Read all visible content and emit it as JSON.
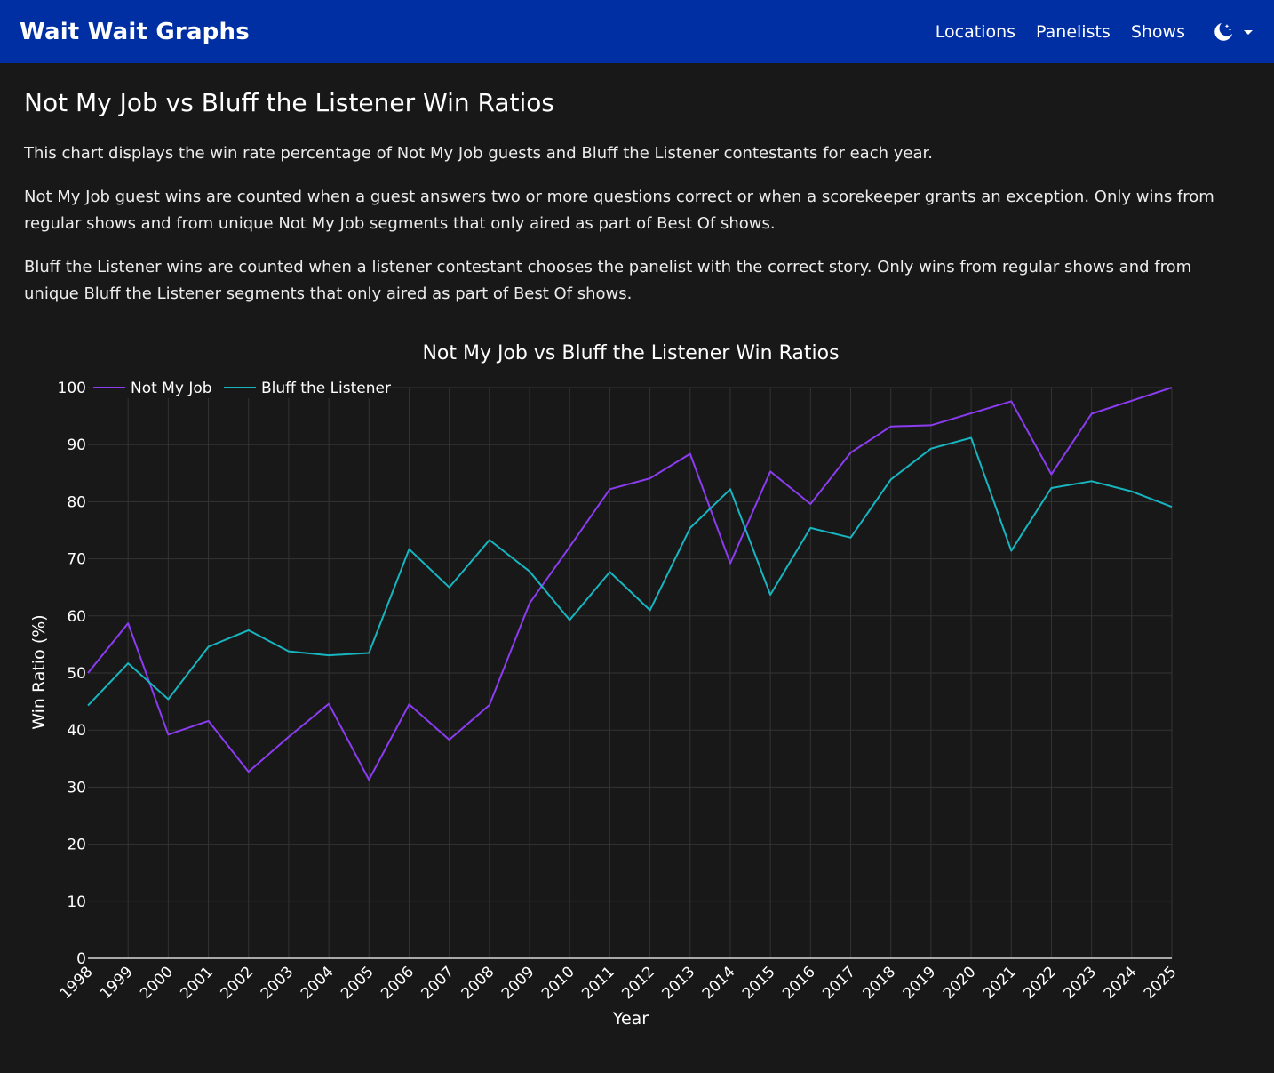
{
  "navbar": {
    "brand": "Wait Wait Graphs",
    "links": [
      "Locations",
      "Panelists",
      "Shows"
    ],
    "theme_icon": "moon-stars-icon"
  },
  "page": {
    "title": "Not My Job vs Bluff the Listener Win Ratios",
    "paragraphs": [
      "This chart displays the win rate percentage of Not My Job guests and Bluff the Listener contestants for each year.",
      "Not My Job guest wins are counted when a guest answers two or more questions correct or when a scorekeeper grants an exception. Only wins from regular shows and from unique Not My Job segments that only aired as part of Best Of shows.",
      "Bluff the Listener wins are counted when a listener contestant chooses the panelist with the correct story. Only wins from regular shows and from unique Bluff the Listener segments that only aired as part of Best Of shows."
    ]
  },
  "chart_data": {
    "type": "line",
    "title": "Not My Job vs Bluff the Listener Win Ratios",
    "xlabel": "Year",
    "ylabel": "Win Ratio (%)",
    "ylim": [
      0,
      100
    ],
    "yticks": [
      0,
      10,
      20,
      30,
      40,
      50,
      60,
      70,
      80,
      90,
      100
    ],
    "grid": true,
    "legend": "top-left",
    "x": [
      "1998",
      "1999",
      "2000",
      "2001",
      "2002",
      "2003",
      "2004",
      "2005",
      "2006",
      "2007",
      "2008",
      "2009",
      "2010",
      "2011",
      "2012",
      "2013",
      "2014",
      "2015",
      "2016",
      "2017",
      "2018",
      "2019",
      "2020",
      "2021",
      "2022",
      "2023",
      "2024",
      "2025"
    ],
    "series": [
      {
        "name": "Not My Job",
        "color": "#8b3cf0",
        "values": [
          50,
          58.7,
          39.2,
          41.6,
          32.7,
          38.8,
          44.6,
          31.3,
          44.5,
          38.3,
          44.4,
          62.2,
          72.1,
          82.2,
          84.1,
          88.4,
          69.2,
          85.3,
          79.6,
          88.6,
          93.2,
          93.4,
          95.5,
          97.6,
          84.8,
          95.4,
          97.7,
          100
        ]
      },
      {
        "name": "Bluff the Listener",
        "color": "#17b5c0",
        "values": [
          44.3,
          51.7,
          45.4,
          54.6,
          57.5,
          53.8,
          53.1,
          53.5,
          71.7,
          65.0,
          73.3,
          67.8,
          59.3,
          67.7,
          61.0,
          75.4,
          82.2,
          63.7,
          75.4,
          73.7,
          83.9,
          89.3,
          91.2,
          71.4,
          82.4,
          83.6,
          81.8,
          79.1
        ]
      }
    ]
  },
  "colors": {
    "navbar": "#002fa3",
    "background": "#181818",
    "grid": "#333333"
  }
}
